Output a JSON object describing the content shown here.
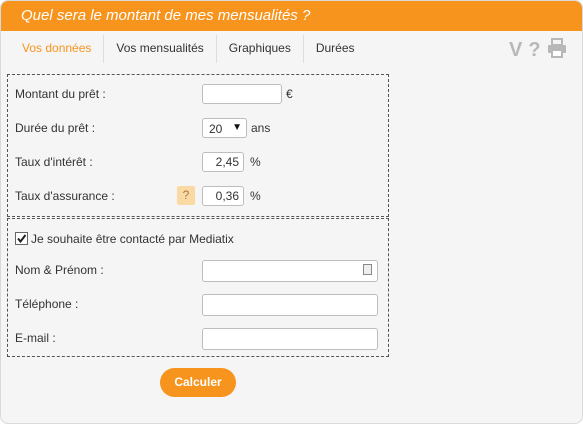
{
  "header": {
    "title": "Quel sera le montant de mes mensualités ?"
  },
  "tabs": [
    {
      "label": "Vos données",
      "active": true
    },
    {
      "label": "Vos mensualités"
    },
    {
      "label": "Graphiques"
    },
    {
      "label": "Durées"
    }
  ],
  "tools": {
    "v_label": "V",
    "help_label": "?",
    "print_icon": "printer-icon"
  },
  "loan": {
    "amount_label": "Montant du prêt :",
    "amount_value": "",
    "amount_unit": "€",
    "duration_label": "Durée du prêt :",
    "duration_value": "20",
    "duration_unit": "ans",
    "rate_label": "Taux d'intérêt :",
    "rate_value": "2,45",
    "rate_unit": "%",
    "insurance_label": "Taux d'assurance :",
    "insurance_help": "?",
    "insurance_value": "0,36",
    "insurance_unit": "%"
  },
  "contact": {
    "checkbox_label": "Je souhaite être contacté par Mediatix",
    "checked": true,
    "name_label": "Nom & Prénom :",
    "name_value": "",
    "phone_label": "Téléphone :",
    "phone_value": "",
    "email_label": "E-mail :",
    "email_value": ""
  },
  "actions": {
    "submit_label": "Calculer"
  },
  "colors": {
    "accent": "#f7941d",
    "help_bg": "#fbd9a5",
    "panel_bg": "#f5f5f5"
  }
}
